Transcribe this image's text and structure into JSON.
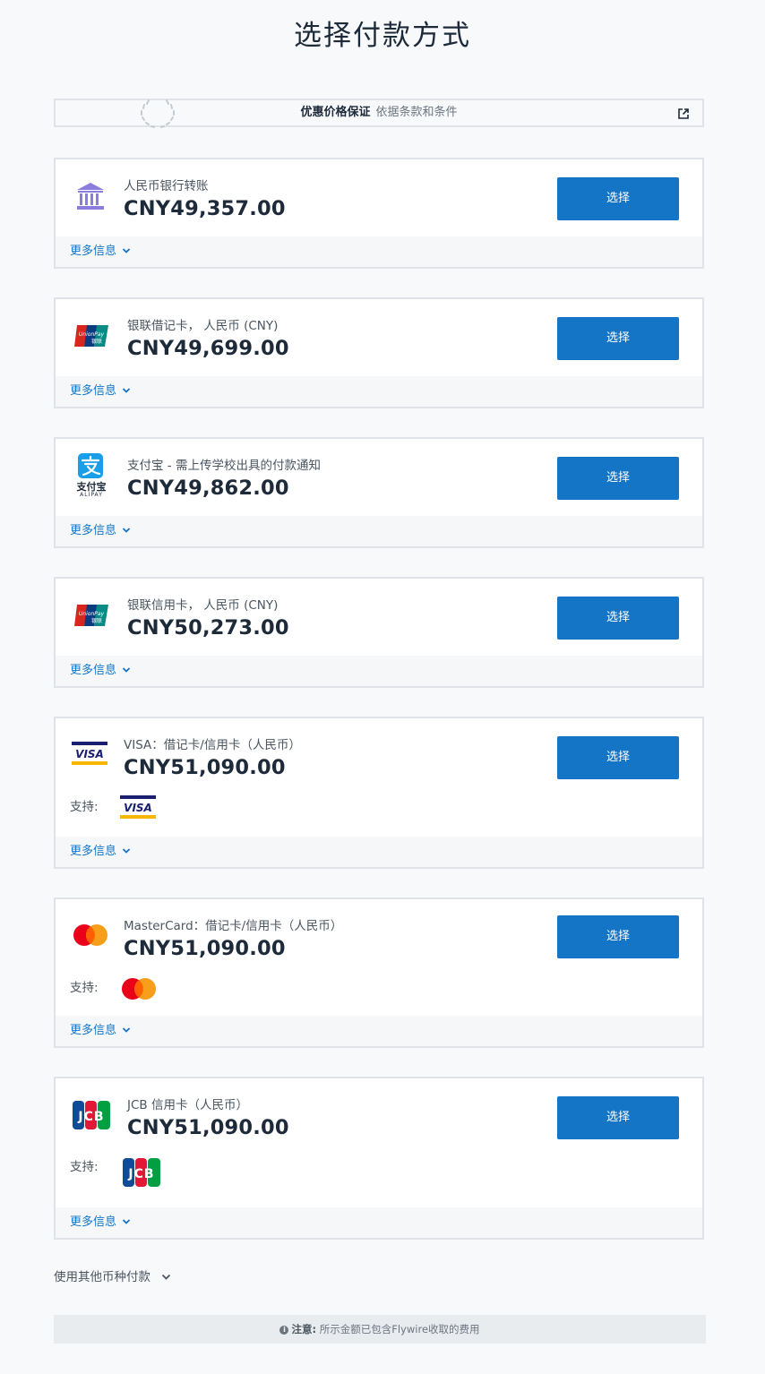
{
  "page": {
    "title": "选择付款方式"
  },
  "guarantee": {
    "title": "优惠价格保证",
    "subtitle": "依据条款和条件"
  },
  "colors": {
    "accent": "#1475c7",
    "bank_icon": "#8a7dde"
  },
  "common": {
    "select_label": "选择",
    "more_info_label": "更多信息",
    "support_label": "支持:"
  },
  "methods": [
    {
      "icon": "bank-icon",
      "label": "人民币银行转账",
      "amount": "CNY49,357.00"
    },
    {
      "icon": "unionpay-logo",
      "label": "银联借记卡， 人民币 (CNY)",
      "amount": "CNY49,699.00"
    },
    {
      "icon": "alipay-logo",
      "label": "支付宝 - 需上传学校出具的付款通知",
      "amount": "CNY49,862.00",
      "logo_text": "支付宝",
      "logo_subtext": "ALIPAY"
    },
    {
      "icon": "unionpay-logo",
      "label": "银联信用卡， 人民币 (CNY)",
      "amount": "CNY50,273.00"
    },
    {
      "icon": "visa-logo",
      "label": "VISA：借记卡/信用卡（人民币）",
      "amount": "CNY51,090.00",
      "logo_text": "VISA"
    },
    {
      "icon": "mastercard-logo",
      "label": "MasterCard：借记卡/信用卡（人民币）",
      "amount": "CNY51,090.00"
    },
    {
      "icon": "jcb-logo",
      "label": "JCB 信用卡（人民币）",
      "amount": "CNY51,090.00",
      "logo_text": "JCB"
    }
  ],
  "footer": {
    "other_currency": "使用其他币种付款",
    "note_label": "注意:",
    "note_text": "所示金额已包含Flywire收取的费用"
  }
}
